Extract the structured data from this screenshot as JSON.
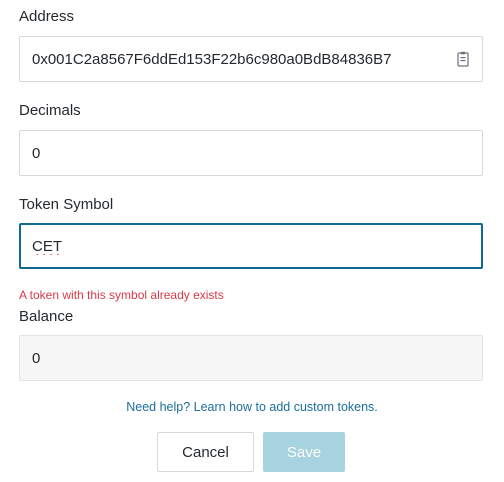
{
  "address": {
    "label": "Address",
    "value": "0x001C2a8567F6ddEd153F22b6c980a0BdB84836B7",
    "icon": "copy-icon"
  },
  "decimals": {
    "label": "Decimals",
    "value": "0"
  },
  "token_symbol": {
    "label": "Token Symbol",
    "value": "CET",
    "error": "A token with this symbol already exists"
  },
  "balance": {
    "label": "Balance",
    "value": "0"
  },
  "help_link": "Need help? Learn how to add custom tokens.",
  "buttons": {
    "cancel": "Cancel",
    "save": "Save"
  },
  "colors": {
    "error": "#d73a49",
    "link": "#1b6f9a",
    "focus_border": "#0f6a8f",
    "save_disabled_bg": "#a6d3df"
  }
}
